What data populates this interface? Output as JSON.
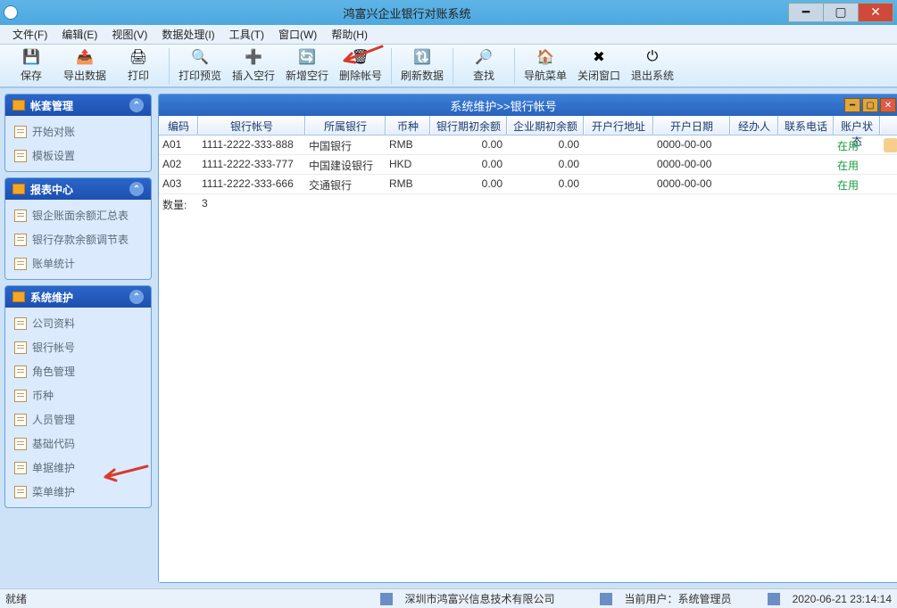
{
  "app": {
    "title": "鸿富兴企业银行对账系统"
  },
  "menu": [
    "文件(F)",
    "编辑(E)",
    "视图(V)",
    "数据处理(I)",
    "工具(T)",
    "窗口(W)",
    "帮助(H)"
  ],
  "toolbar": [
    {
      "icon": "💾",
      "label": "保存"
    },
    {
      "icon": "📤",
      "label": "导出数据"
    },
    {
      "icon": "🖨",
      "label": "打印"
    },
    {
      "sep": true
    },
    {
      "icon": "🔍",
      "label": "打印预览"
    },
    {
      "icon": "➕",
      "label": "插入空行"
    },
    {
      "icon": "🔄",
      "label": "新增空行"
    },
    {
      "icon": "🗑",
      "label": "删除帐号"
    },
    {
      "sep": true
    },
    {
      "icon": "🔃",
      "label": "刷新数据"
    },
    {
      "sep": true
    },
    {
      "icon": "🔎",
      "label": "查找"
    },
    {
      "sep": true
    },
    {
      "icon": "🏠",
      "label": "导航菜单"
    },
    {
      "icon": "✖",
      "label": "关闭窗口"
    },
    {
      "icon": "⏻",
      "label": "退出系统"
    }
  ],
  "sidebar": {
    "account_mgmt": {
      "title": "帐套管理",
      "items": [
        "开始对账",
        "模板设置"
      ]
    },
    "report_center": {
      "title": "报表中心",
      "items": [
        "银企账面余额汇总表",
        "银行存款余额调节表",
        "账单统计"
      ]
    },
    "sys_maint": {
      "title": "系统维护",
      "items": [
        "公司资料",
        "银行帐号",
        "角色管理",
        "币种",
        "人员管理",
        "基础代码",
        "单据维护",
        "菜单维护"
      ]
    }
  },
  "doc": {
    "title": "系统维护>>银行帐号",
    "columns": [
      "编码",
      "银行帐号",
      "所属银行",
      "币种",
      "银行期初余额",
      "企业期初余额",
      "开户行地址",
      "开户日期",
      "经办人",
      "联系电话",
      "账户状态",
      ""
    ],
    "rows": [
      {
        "code": "A01",
        "acct": "1111-2222-333-888",
        "bank": "中国银行",
        "cur": "RMB",
        "bopen": "0.00",
        "copen": "0.00",
        "addr": "",
        "date": "0000-00-00",
        "handler": "",
        "phone": "",
        "status": "在用"
      },
      {
        "code": "A02",
        "acct": "1111-2222-333-777",
        "bank": "中国建设银行",
        "cur": "HKD",
        "bopen": "0.00",
        "copen": "0.00",
        "addr": "",
        "date": "0000-00-00",
        "handler": "",
        "phone": "",
        "status": "在用"
      },
      {
        "code": "A03",
        "acct": "1111-2222-333-666",
        "bank": "交通银行",
        "cur": "RMB",
        "bopen": "0.00",
        "copen": "0.00",
        "addr": "",
        "date": "0000-00-00",
        "handler": "",
        "phone": "",
        "status": "在用"
      }
    ],
    "count_label": "数量:",
    "count": "3"
  },
  "status": {
    "ready": "就绪",
    "company": "深圳市鸿富兴信息技术有限公司",
    "user_label": "当前用户：系统管理员",
    "time": "2020-06-21 23:14:14"
  }
}
